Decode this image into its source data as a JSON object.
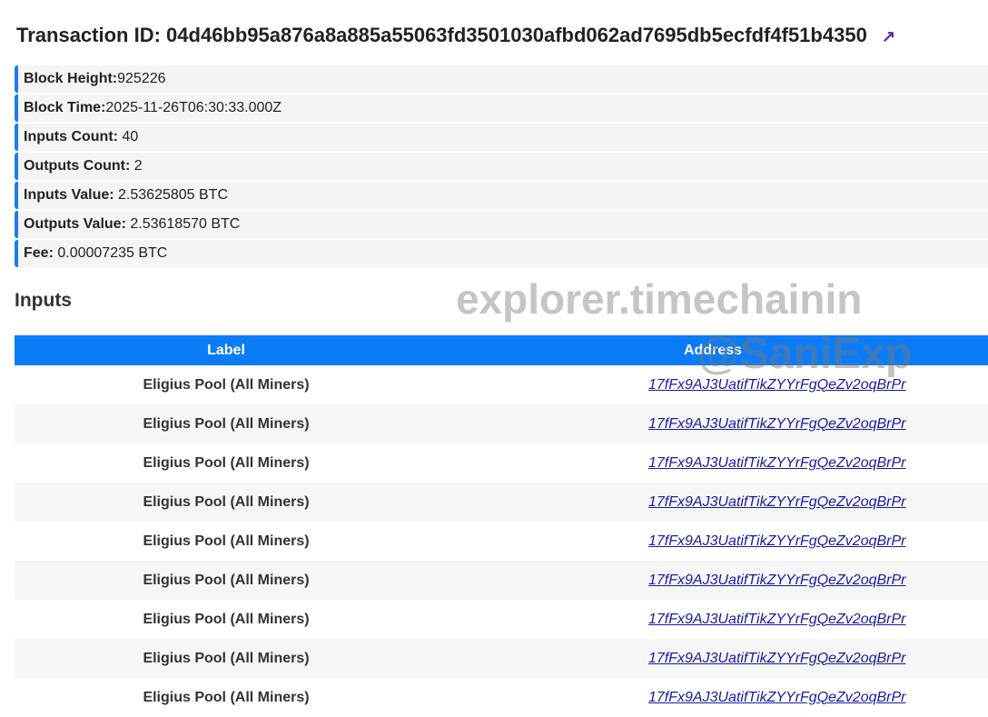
{
  "title": {
    "label": "Transaction ID:",
    "txid": "04d46bb95a876a8a885a55063fd3501030afbd062ad7695db5ecfdf4f51b4350",
    "link_icon": "external-link-icon"
  },
  "info": [
    {
      "label": "Block Height:",
      "value": "925226"
    },
    {
      "label": "Block Time:",
      "value": "2025-11-26T06:30:33.000Z"
    },
    {
      "label": "Inputs Count:",
      "value": " 40"
    },
    {
      "label": "Outputs Count:",
      "value": " 2"
    },
    {
      "label": "Inputs Value:",
      "value": " 2.53625805 BTC"
    },
    {
      "label": "Outputs Value:",
      "value": " 2.53618570 BTC"
    },
    {
      "label": "Fee:",
      "value": " 0.00007235 BTC"
    }
  ],
  "inputs": {
    "heading": "Inputs",
    "columns": [
      "Label",
      "Address"
    ],
    "rows": [
      {
        "label": "Eligius Pool (All Miners)",
        "address": "17fFx9AJ3UatifTikZYYrFgQeZv2oqBrPr"
      },
      {
        "label": "Eligius Pool (All Miners)",
        "address": "17fFx9AJ3UatifTikZYYrFgQeZv2oqBrPr"
      },
      {
        "label": "Eligius Pool (All Miners)",
        "address": "17fFx9AJ3UatifTikZYYrFgQeZv2oqBrPr"
      },
      {
        "label": "Eligius Pool (All Miners)",
        "address": "17fFx9AJ3UatifTikZYYrFgQeZv2oqBrPr"
      },
      {
        "label": "Eligius Pool (All Miners)",
        "address": "17fFx9AJ3UatifTikZYYrFgQeZv2oqBrPr"
      },
      {
        "label": "Eligius Pool (All Miners)",
        "address": "17fFx9AJ3UatifTikZYYrFgQeZv2oqBrPr"
      },
      {
        "label": "Eligius Pool (All Miners)",
        "address": "17fFx9AJ3UatifTikZYYrFgQeZv2oqBrPr"
      },
      {
        "label": "Eligius Pool (All Miners)",
        "address": "17fFx9AJ3UatifTikZYYrFgQeZv2oqBrPr"
      },
      {
        "label": "Eligius Pool (All Miners)",
        "address": "17fFx9AJ3UatifTikZYYrFgQeZv2oqBrPr"
      }
    ]
  },
  "watermark": {
    "site": "explorer.timechainin",
    "handle": "@SaniExp"
  }
}
